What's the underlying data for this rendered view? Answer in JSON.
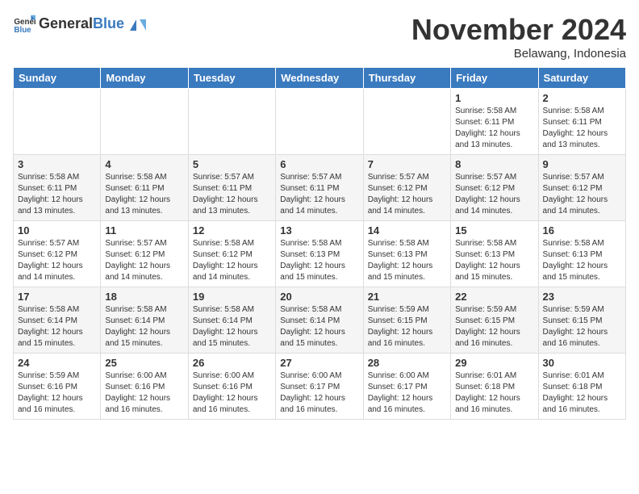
{
  "logo": {
    "general": "General",
    "blue": "Blue"
  },
  "header": {
    "month": "November 2024",
    "location": "Belawang, Indonesia"
  },
  "weekdays": [
    "Sunday",
    "Monday",
    "Tuesday",
    "Wednesday",
    "Thursday",
    "Friday",
    "Saturday"
  ],
  "weeks": [
    [
      {
        "day": "",
        "info": ""
      },
      {
        "day": "",
        "info": ""
      },
      {
        "day": "",
        "info": ""
      },
      {
        "day": "",
        "info": ""
      },
      {
        "day": "",
        "info": ""
      },
      {
        "day": "1",
        "info": "Sunrise: 5:58 AM\nSunset: 6:11 PM\nDaylight: 12 hours\nand 13 minutes."
      },
      {
        "day": "2",
        "info": "Sunrise: 5:58 AM\nSunset: 6:11 PM\nDaylight: 12 hours\nand 13 minutes."
      }
    ],
    [
      {
        "day": "3",
        "info": "Sunrise: 5:58 AM\nSunset: 6:11 PM\nDaylight: 12 hours\nand 13 minutes."
      },
      {
        "day": "4",
        "info": "Sunrise: 5:58 AM\nSunset: 6:11 PM\nDaylight: 12 hours\nand 13 minutes."
      },
      {
        "day": "5",
        "info": "Sunrise: 5:57 AM\nSunset: 6:11 PM\nDaylight: 12 hours\nand 13 minutes."
      },
      {
        "day": "6",
        "info": "Sunrise: 5:57 AM\nSunset: 6:11 PM\nDaylight: 12 hours\nand 14 minutes."
      },
      {
        "day": "7",
        "info": "Sunrise: 5:57 AM\nSunset: 6:12 PM\nDaylight: 12 hours\nand 14 minutes."
      },
      {
        "day": "8",
        "info": "Sunrise: 5:57 AM\nSunset: 6:12 PM\nDaylight: 12 hours\nand 14 minutes."
      },
      {
        "day": "9",
        "info": "Sunrise: 5:57 AM\nSunset: 6:12 PM\nDaylight: 12 hours\nand 14 minutes."
      }
    ],
    [
      {
        "day": "10",
        "info": "Sunrise: 5:57 AM\nSunset: 6:12 PM\nDaylight: 12 hours\nand 14 minutes."
      },
      {
        "day": "11",
        "info": "Sunrise: 5:57 AM\nSunset: 6:12 PM\nDaylight: 12 hours\nand 14 minutes."
      },
      {
        "day": "12",
        "info": "Sunrise: 5:58 AM\nSunset: 6:12 PM\nDaylight: 12 hours\nand 14 minutes."
      },
      {
        "day": "13",
        "info": "Sunrise: 5:58 AM\nSunset: 6:13 PM\nDaylight: 12 hours\nand 15 minutes."
      },
      {
        "day": "14",
        "info": "Sunrise: 5:58 AM\nSunset: 6:13 PM\nDaylight: 12 hours\nand 15 minutes."
      },
      {
        "day": "15",
        "info": "Sunrise: 5:58 AM\nSunset: 6:13 PM\nDaylight: 12 hours\nand 15 minutes."
      },
      {
        "day": "16",
        "info": "Sunrise: 5:58 AM\nSunset: 6:13 PM\nDaylight: 12 hours\nand 15 minutes."
      }
    ],
    [
      {
        "day": "17",
        "info": "Sunrise: 5:58 AM\nSunset: 6:14 PM\nDaylight: 12 hours\nand 15 minutes."
      },
      {
        "day": "18",
        "info": "Sunrise: 5:58 AM\nSunset: 6:14 PM\nDaylight: 12 hours\nand 15 minutes."
      },
      {
        "day": "19",
        "info": "Sunrise: 5:58 AM\nSunset: 6:14 PM\nDaylight: 12 hours\nand 15 minutes."
      },
      {
        "day": "20",
        "info": "Sunrise: 5:58 AM\nSunset: 6:14 PM\nDaylight: 12 hours\nand 15 minutes."
      },
      {
        "day": "21",
        "info": "Sunrise: 5:59 AM\nSunset: 6:15 PM\nDaylight: 12 hours\nand 16 minutes."
      },
      {
        "day": "22",
        "info": "Sunrise: 5:59 AM\nSunset: 6:15 PM\nDaylight: 12 hours\nand 16 minutes."
      },
      {
        "day": "23",
        "info": "Sunrise: 5:59 AM\nSunset: 6:15 PM\nDaylight: 12 hours\nand 16 minutes."
      }
    ],
    [
      {
        "day": "24",
        "info": "Sunrise: 5:59 AM\nSunset: 6:16 PM\nDaylight: 12 hours\nand 16 minutes."
      },
      {
        "day": "25",
        "info": "Sunrise: 6:00 AM\nSunset: 6:16 PM\nDaylight: 12 hours\nand 16 minutes."
      },
      {
        "day": "26",
        "info": "Sunrise: 6:00 AM\nSunset: 6:16 PM\nDaylight: 12 hours\nand 16 minutes."
      },
      {
        "day": "27",
        "info": "Sunrise: 6:00 AM\nSunset: 6:17 PM\nDaylight: 12 hours\nand 16 minutes."
      },
      {
        "day": "28",
        "info": "Sunrise: 6:00 AM\nSunset: 6:17 PM\nDaylight: 12 hours\nand 16 minutes."
      },
      {
        "day": "29",
        "info": "Sunrise: 6:01 AM\nSunset: 6:18 PM\nDaylight: 12 hours\nand 16 minutes."
      },
      {
        "day": "30",
        "info": "Sunrise: 6:01 AM\nSunset: 6:18 PM\nDaylight: 12 hours\nand 16 minutes."
      }
    ]
  ]
}
